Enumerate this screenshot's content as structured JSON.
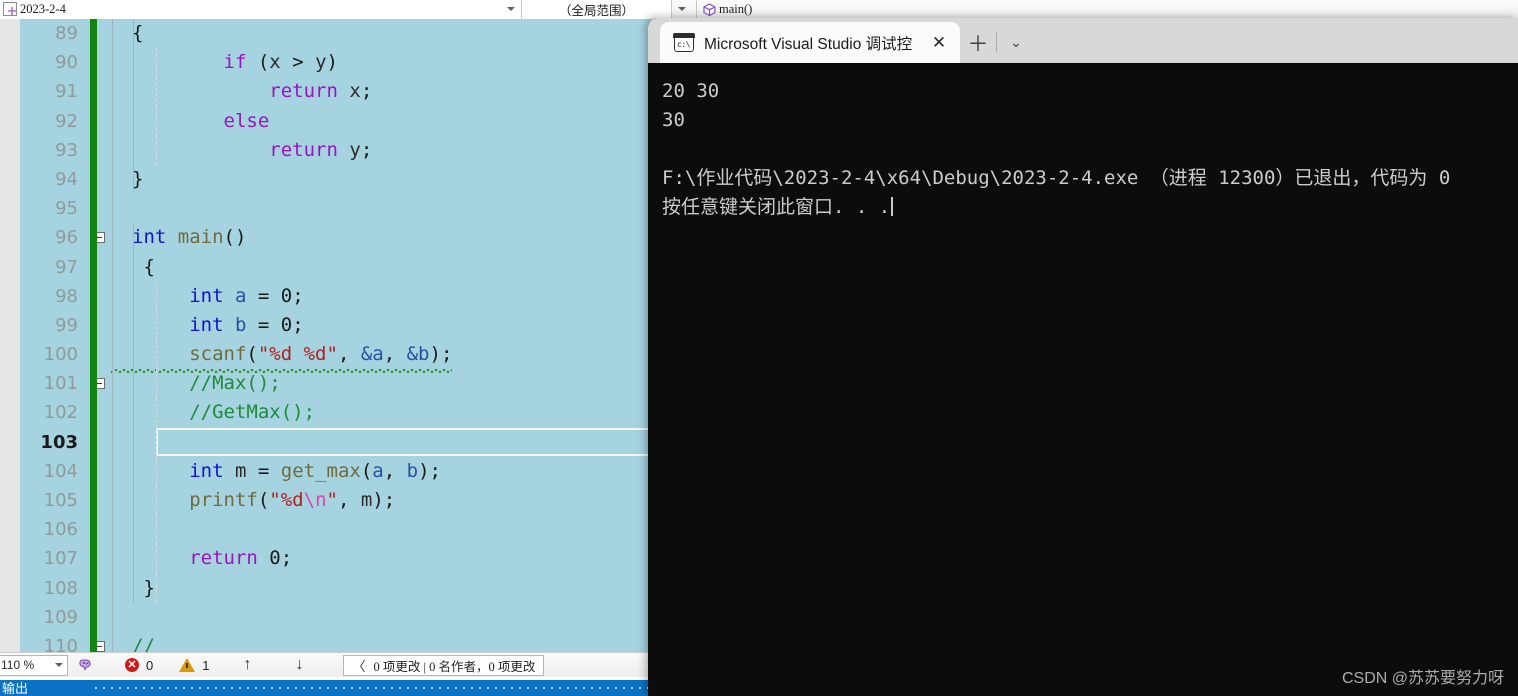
{
  "navbar": {
    "project_selector": "2023-2-4",
    "scope_selector": "（全局范围）",
    "member_selector": "main()",
    "doc_icon": "document-icon",
    "cube_icon": "method-cube-icon",
    "caret_icon": "chevron-down-icon"
  },
  "editor": {
    "first_line_number": 89,
    "current_line": 103,
    "lines": [
      {
        "n": 89,
        "fold": false,
        "tokens": [
          {
            "t": "{",
            "c": "punct"
          }
        ]
      },
      {
        "n": 90,
        "fold": false,
        "tokens": [
          {
            "t": "        ",
            "c": "punct"
          },
          {
            "t": "if",
            "c": "kw2"
          },
          {
            "t": " (",
            "c": "punct"
          },
          {
            "t": "x",
            "c": "id"
          },
          {
            "t": " > ",
            "c": "punct"
          },
          {
            "t": "y",
            "c": "id"
          },
          {
            "t": ")",
            "c": "punct"
          }
        ]
      },
      {
        "n": 91,
        "fold": false,
        "tokens": [
          {
            "t": "            ",
            "c": "punct"
          },
          {
            "t": "return",
            "c": "kw2"
          },
          {
            "t": " ",
            "c": "punct"
          },
          {
            "t": "x",
            "c": "id"
          },
          {
            "t": ";",
            "c": "punct"
          }
        ]
      },
      {
        "n": 92,
        "fold": false,
        "tokens": [
          {
            "t": "        ",
            "c": "punct"
          },
          {
            "t": "else",
            "c": "kw2"
          }
        ]
      },
      {
        "n": 93,
        "fold": false,
        "tokens": [
          {
            "t": "            ",
            "c": "punct"
          },
          {
            "t": "return",
            "c": "kw2"
          },
          {
            "t": " ",
            "c": "punct"
          },
          {
            "t": "y",
            "c": "id"
          },
          {
            "t": ";",
            "c": "punct"
          }
        ]
      },
      {
        "n": 94,
        "fold": false,
        "tokens": [
          {
            "t": "}",
            "c": "punct"
          }
        ]
      },
      {
        "n": 95,
        "fold": false,
        "tokens": []
      },
      {
        "n": 96,
        "fold": true,
        "tokens": [
          {
            "t": "int",
            "c": "kw"
          },
          {
            "t": " ",
            "c": "punct"
          },
          {
            "t": "main",
            "c": "fn"
          },
          {
            "t": "()",
            "c": "punct"
          }
        ]
      },
      {
        "n": 97,
        "fold": false,
        "tokens": [
          {
            "t": " {",
            "c": "punct"
          }
        ]
      },
      {
        "n": 98,
        "fold": false,
        "tokens": [
          {
            "t": "     ",
            "c": "punct"
          },
          {
            "t": "int",
            "c": "kw"
          },
          {
            "t": " ",
            "c": "punct"
          },
          {
            "t": "a",
            "c": "var"
          },
          {
            "t": " = ",
            "c": "punct"
          },
          {
            "t": "0",
            "c": "num"
          },
          {
            "t": ";",
            "c": "punct"
          }
        ]
      },
      {
        "n": 99,
        "fold": false,
        "tokens": [
          {
            "t": "     ",
            "c": "punct"
          },
          {
            "t": "int",
            "c": "kw"
          },
          {
            "t": " ",
            "c": "punct"
          },
          {
            "t": "b",
            "c": "var"
          },
          {
            "t": " = ",
            "c": "punct"
          },
          {
            "t": "0",
            "c": "num"
          },
          {
            "t": ";",
            "c": "punct"
          }
        ]
      },
      {
        "n": 100,
        "fold": false,
        "squiggle": true,
        "tokens": [
          {
            "t": "     ",
            "c": "punct"
          },
          {
            "t": "scanf",
            "c": "fn"
          },
          {
            "t": "(",
            "c": "punct"
          },
          {
            "t": "\"%d %d\"",
            "c": "str"
          },
          {
            "t": ", ",
            "c": "punct"
          },
          {
            "t": "&a",
            "c": "var"
          },
          {
            "t": ", ",
            "c": "punct"
          },
          {
            "t": "&b",
            "c": "var"
          },
          {
            "t": ")",
            "c": "punct"
          },
          {
            "t": ";",
            "c": "punct"
          }
        ]
      },
      {
        "n": 101,
        "fold": true,
        "tokens": [
          {
            "t": "     ",
            "c": "punct"
          },
          {
            "t": "//Max();",
            "c": "cmt"
          }
        ]
      },
      {
        "n": 102,
        "fold": false,
        "tokens": [
          {
            "t": "     ",
            "c": "punct"
          },
          {
            "t": "//GetMax();",
            "c": "cmt"
          }
        ]
      },
      {
        "n": 103,
        "fold": false,
        "current": true,
        "tokens": []
      },
      {
        "n": 104,
        "fold": false,
        "tokens": [
          {
            "t": "     ",
            "c": "punct"
          },
          {
            "t": "int",
            "c": "kw"
          },
          {
            "t": " ",
            "c": "punct"
          },
          {
            "t": "m",
            "c": "id"
          },
          {
            "t": " = ",
            "c": "punct"
          },
          {
            "t": "get_max",
            "c": "fn"
          },
          {
            "t": "(",
            "c": "punct"
          },
          {
            "t": "a",
            "c": "var"
          },
          {
            "t": ", ",
            "c": "punct"
          },
          {
            "t": "b",
            "c": "var"
          },
          {
            "t": ")",
            "c": "punct"
          },
          {
            "t": ";",
            "c": "punct"
          }
        ]
      },
      {
        "n": 105,
        "fold": false,
        "tokens": [
          {
            "t": "     ",
            "c": "punct"
          },
          {
            "t": "printf",
            "c": "fn"
          },
          {
            "t": "(",
            "c": "punct"
          },
          {
            "t": "\"%d",
            "c": "str"
          },
          {
            "t": "\\n",
            "c": "esc"
          },
          {
            "t": "\"",
            "c": "str"
          },
          {
            "t": ", ",
            "c": "punct"
          },
          {
            "t": "m",
            "c": "id"
          },
          {
            "t": ")",
            "c": "punct"
          },
          {
            "t": ";",
            "c": "punct"
          }
        ]
      },
      {
        "n": 106,
        "fold": false,
        "tokens": []
      },
      {
        "n": 107,
        "fold": false,
        "tokens": [
          {
            "t": "     ",
            "c": "punct"
          },
          {
            "t": "return",
            "c": "kw2"
          },
          {
            "t": " ",
            "c": "punct"
          },
          {
            "t": "0",
            "c": "num"
          },
          {
            "t": ";",
            "c": "punct"
          }
        ]
      },
      {
        "n": 108,
        "fold": false,
        "tokens": [
          {
            "t": " }",
            "c": "punct"
          }
        ]
      },
      {
        "n": 109,
        "fold": false,
        "tokens": []
      },
      {
        "n": 110,
        "fold": true,
        "tokens": [
          {
            "t": "//",
            "c": "cmt"
          }
        ]
      }
    ]
  },
  "status_bar": {
    "zoom_level": "110 %",
    "zoom_caret_icon": "chevron-down-icon",
    "intellicode_icon": "intellicode-brain-icon",
    "error_icon": "error-circle-icon",
    "error_count": "0",
    "warning_icon": "warning-triangle-icon",
    "warning_count": "1",
    "prev_icon": "arrow-up-icon",
    "next_icon": "arrow-down-icon",
    "scm_chevron_icon": "chevron-left-icon",
    "scm_text": "0 项更改 | 0 名作者，0 项更改"
  },
  "blue_bar": {
    "text": "输出"
  },
  "terminal": {
    "tab": {
      "icon": "console-window-icon",
      "title": "Microsoft Visual Studio 调试控",
      "close_icon": "close-x-icon"
    },
    "new_tab_icon": "plus-icon",
    "dropdown_icon": "chevron-down-icon",
    "output": [
      "20 30",
      "30",
      "",
      "F:\\作业代码\\2023-2-4\\x64\\Debug\\2023-2-4.exe （进程 12300）已退出，代码为 0",
      "按任意键关闭此窗口. . ."
    ]
  },
  "watermark": {
    "text": "CSDN @苏苏要努力呀"
  },
  "colors": {
    "editor_selection_bg": "#a5d4e0",
    "change_marker_green": "#128412",
    "terminal_bg": "#0c0c0c",
    "vs_blue_bar": "#0a72c4",
    "keyword_blue": "#1212d2",
    "keyword_purple": "#9a13c1",
    "comment_green": "#1f8a3b",
    "string_red": "#b02020"
  }
}
